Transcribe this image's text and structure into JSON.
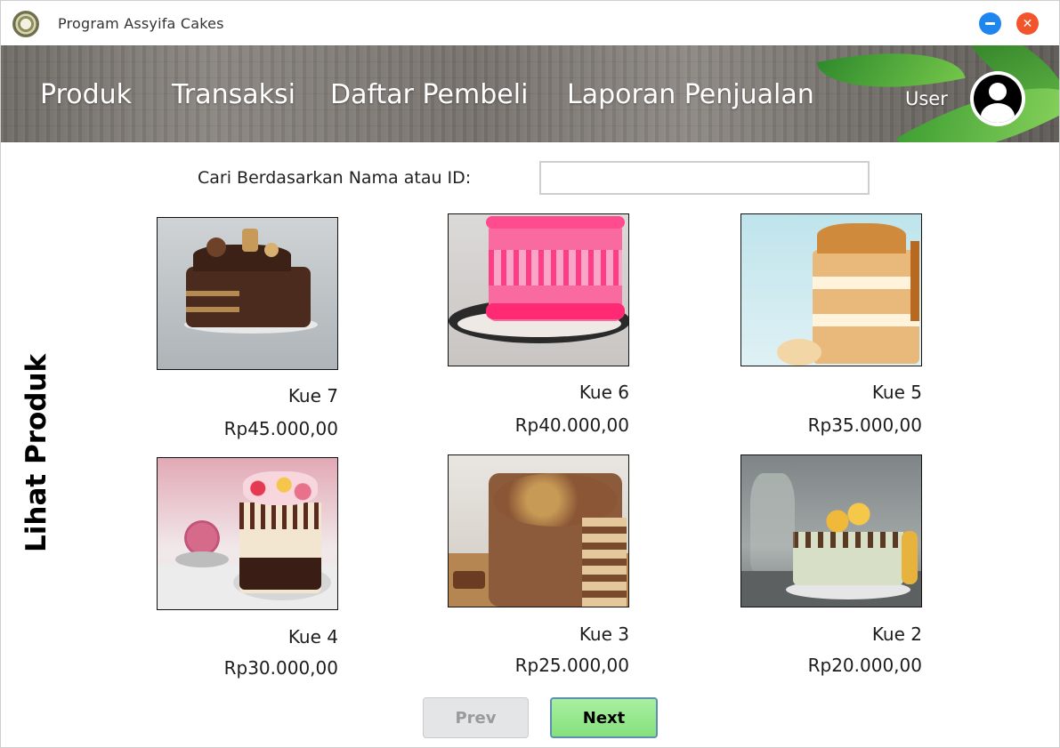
{
  "window": {
    "title": "Program Assyifa Cakes",
    "minimize_icon": "minimize-icon",
    "close_icon": "close-icon"
  },
  "nav": {
    "items": [
      {
        "label": "Produk"
      },
      {
        "label": "Transaksi"
      },
      {
        "label": "Daftar Pembeli"
      },
      {
        "label": "Laporan Penjualan"
      }
    ],
    "user_label": "User",
    "avatar_icon": "user-avatar-icon"
  },
  "page": {
    "side_title": "Lihat Produk"
  },
  "search": {
    "label": "Cari Berdasarkan Nama atau ID:",
    "value": "",
    "placeholder": ""
  },
  "products": [
    {
      "name": "Kue 7",
      "price": "Rp45.000,00",
      "image": "chocolate-drip-cake"
    },
    {
      "name": "Kue 6",
      "price": "Rp40.000,00",
      "image": "pink-drip-cake"
    },
    {
      "name": "Kue 5",
      "price": "Rp35.000,00",
      "image": "naked-caramel-cake"
    },
    {
      "name": "Kue 4",
      "price": "Rp30.000,00",
      "image": "berry-macaron-cake"
    },
    {
      "name": "Kue 3",
      "price": "Rp25.000,00",
      "image": "chocolate-crunch-cake"
    },
    {
      "name": "Kue 2",
      "price": "Rp20.000,00",
      "image": "gold-macaron-cake"
    }
  ],
  "pagination": {
    "prev_label": "Prev",
    "next_label": "Next"
  },
  "colors": {
    "accent_minimize": "#1f86f0",
    "accent_close": "#f2552c",
    "next_button": "#85e07c",
    "prev_button_disabled": "#e4e5e7"
  }
}
